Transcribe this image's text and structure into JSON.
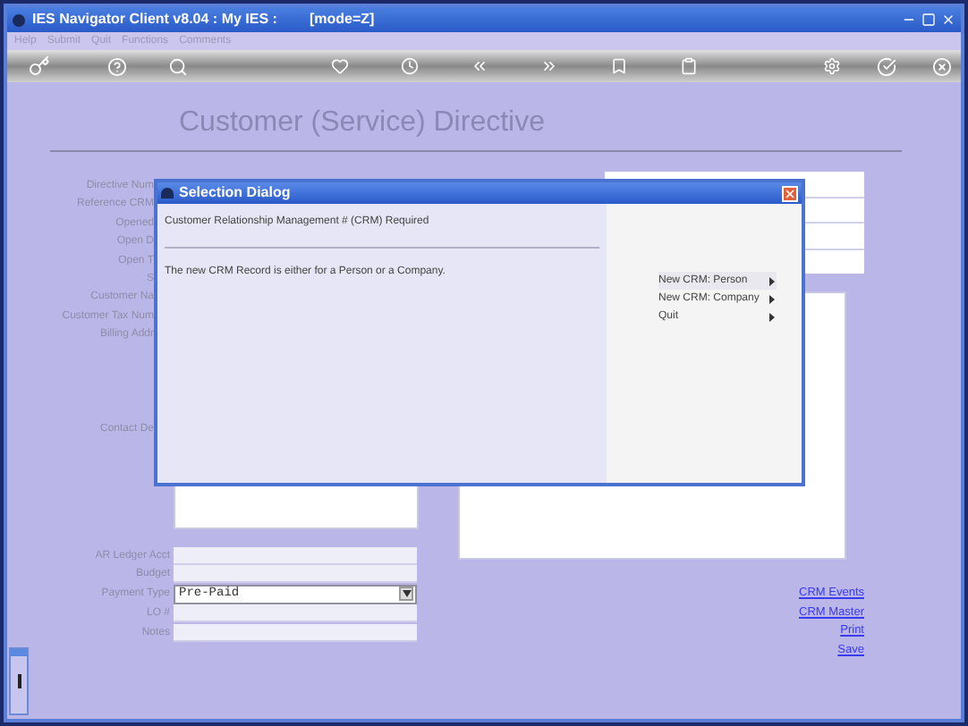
{
  "window": {
    "title": "IES Navigator Client v8.04 : My IES :",
    "mode": "[mode=Z]"
  },
  "menu": [
    "Help",
    "Submit",
    "Quit",
    "Functions",
    "Comments"
  ],
  "form": {
    "title": "Customer (Service) Directive",
    "upper_labels": [
      "Directive Num",
      "Reference CRM",
      "Opened",
      "Open D",
      "Open T",
      "S",
      "Customer Na",
      "Customer Tax Num",
      "Billing Addr"
    ],
    "contact_label": "Contact De",
    "lower_fields": [
      {
        "label": "AR Ledger Acct",
        "kind": "text"
      },
      {
        "label": "Budget",
        "kind": "text"
      },
      {
        "label": "Payment Type",
        "kind": "dropdown",
        "value": "Pre-Paid"
      },
      {
        "label": "LO #",
        "kind": "text"
      },
      {
        "label": "Notes",
        "kind": "text"
      }
    ]
  },
  "links": [
    "CRM Events",
    "CRM Master",
    "Print",
    "Save"
  ],
  "dialog": {
    "title": "Selection Dialog",
    "header": "Customer Relationship Management # (CRM) Required",
    "message": "The new CRM Record is either for a Person or a Company.",
    "options": [
      {
        "label": "New CRM: Person",
        "selected": true
      },
      {
        "label": "New CRM: Company",
        "selected": false
      },
      {
        "label": "Quit",
        "selected": false
      }
    ]
  }
}
